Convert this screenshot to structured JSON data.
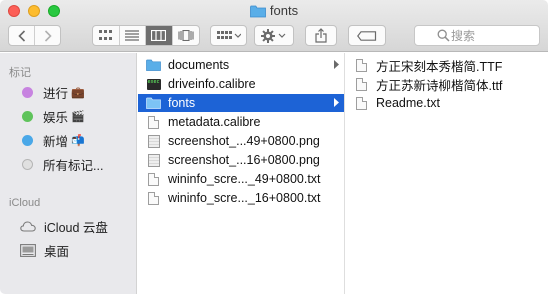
{
  "window": {
    "title": "fonts"
  },
  "toolbar": {
    "search_placeholder": "搜索"
  },
  "sidebar": {
    "section_tags": "标记",
    "tags": [
      {
        "label": "进行",
        "emoji": "💼",
        "color": "#c783e0"
      },
      {
        "label": "娱乐",
        "emoji": "🎬",
        "color": "#5fc35b"
      },
      {
        "label": "新增",
        "emoji": "📬",
        "color": "#4aa8e8"
      },
      {
        "label": "所有标记...",
        "emoji": "",
        "color": "#d9d9d9"
      }
    ],
    "section_icloud": "iCloud",
    "icloud_items": [
      {
        "label": "iCloud 云盘",
        "icon": "cloud-icon"
      },
      {
        "label": "桌面",
        "icon": "desktop-icon"
      }
    ]
  },
  "column1": {
    "items": [
      {
        "name": "documents",
        "kind": "folder",
        "has_children": true,
        "selected": false
      },
      {
        "name": "driveinfo.calibre",
        "kind": "exec",
        "has_children": false,
        "selected": false
      },
      {
        "name": "fonts",
        "kind": "folder",
        "has_children": true,
        "selected": true
      },
      {
        "name": "metadata.calibre",
        "kind": "file",
        "has_children": false,
        "selected": false
      },
      {
        "name": "screenshot_...49+0800.png",
        "kind": "image",
        "has_children": false,
        "selected": false
      },
      {
        "name": "screenshot_...16+0800.png",
        "kind": "image",
        "has_children": false,
        "selected": false
      },
      {
        "name": "wininfo_scre..._49+0800.txt",
        "kind": "file",
        "has_children": false,
        "selected": false
      },
      {
        "name": "wininfo_scre..._16+0800.txt",
        "kind": "file",
        "has_children": false,
        "selected": false
      }
    ]
  },
  "column2": {
    "items": [
      {
        "name": "方正宋刻本秀楷简.TTF",
        "kind": "file"
      },
      {
        "name": "方正苏新诗柳楷简体.ttf",
        "kind": "file"
      },
      {
        "name": "Readme.txt",
        "kind": "file"
      }
    ]
  },
  "colors": {
    "selection": "#1d63d6",
    "folder": "#5aaee8",
    "sidebar_bg": "#e9e9ec"
  }
}
